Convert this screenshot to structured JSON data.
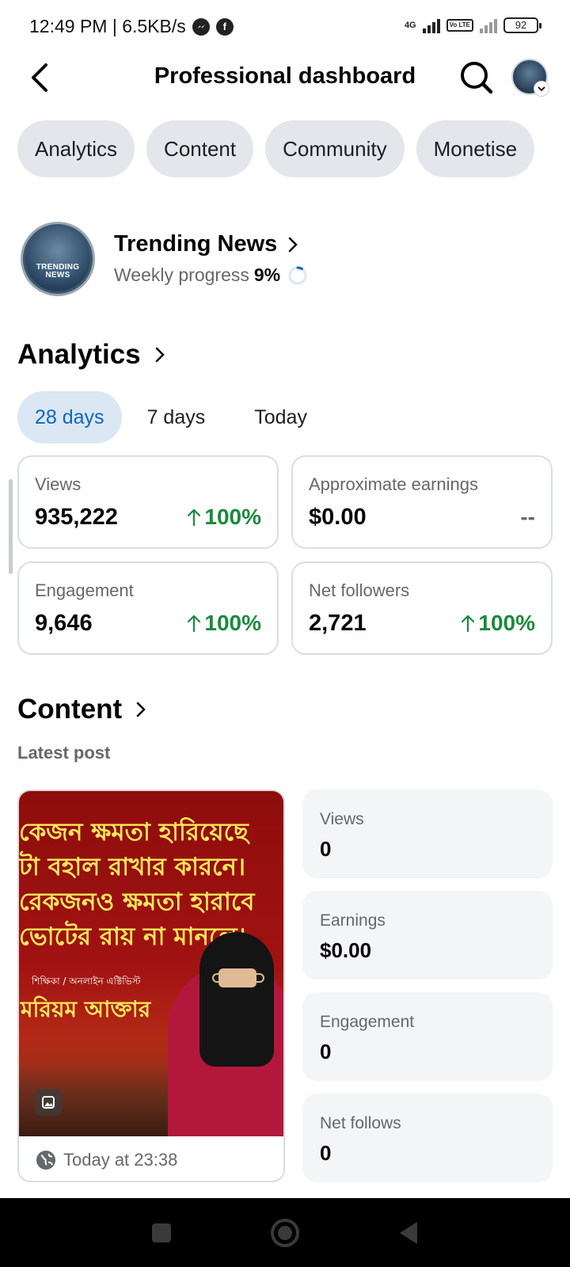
{
  "status_bar": {
    "time_speed": "12:49 PM | 6.5KB/s",
    "network": "4G",
    "volte": "Vo LTE",
    "battery": "92"
  },
  "header": {
    "title": "Professional dashboard"
  },
  "tabs": [
    {
      "label": "Analytics"
    },
    {
      "label": "Content"
    },
    {
      "label": "Community"
    },
    {
      "label": "Monetise"
    }
  ],
  "profile": {
    "logo_text": "TRENDING NEWS",
    "name": "Trending News",
    "progress_label": "Weekly progress",
    "progress_value": "9%",
    "progress_fraction": 0.09
  },
  "analytics": {
    "title": "Analytics",
    "ranges": [
      {
        "label": "28 days",
        "active": true
      },
      {
        "label": "7 days",
        "active": false
      },
      {
        "label": "Today",
        "active": false
      }
    ],
    "stats": [
      {
        "label": "Views",
        "value": "935,222",
        "delta": "100%",
        "trend": "up"
      },
      {
        "label": "Approximate earnings",
        "value": "$0.00",
        "delta": "--",
        "trend": "none"
      },
      {
        "label": "Engagement",
        "value": "9,646",
        "delta": "100%",
        "trend": "up"
      },
      {
        "label": "Net followers",
        "value": "2,721",
        "delta": "100%",
        "trend": "up"
      }
    ]
  },
  "content": {
    "title": "Content",
    "latest_label": "Latest post",
    "post": {
      "lines": [
        "কেজন ক্ষমতা হারিয়েছে",
        "টা বহাল রাখার কারনে।",
        "রেকজনও ক্ষমতা হারাবে",
        "ভোটের রায় না মানলে।"
      ],
      "role": "শিক্ষিকা / অনলাইন এক্টিভিস্ট",
      "name": "মরিয়ম আক্তার",
      "time": "Today at 23:38"
    },
    "metrics": [
      {
        "label": "Views",
        "value": "0"
      },
      {
        "label": "Earnings",
        "value": "$0.00"
      },
      {
        "label": "Engagement",
        "value": "0"
      },
      {
        "label": "Net follows",
        "value": "0"
      }
    ]
  },
  "colors": {
    "accent_blue": "#0a66c2",
    "positive_green": "#1b8a3d",
    "chip_bg": "#e4e6eb",
    "post_bg": "#a11212",
    "post_text": "#ffe95a"
  },
  "icons": {
    "back": "back-arrow-icon",
    "search": "search-icon",
    "chevron": "chevron-right-icon",
    "trend": "arrow-up-icon",
    "globe": "globe-icon",
    "photo": "photo-icon"
  }
}
